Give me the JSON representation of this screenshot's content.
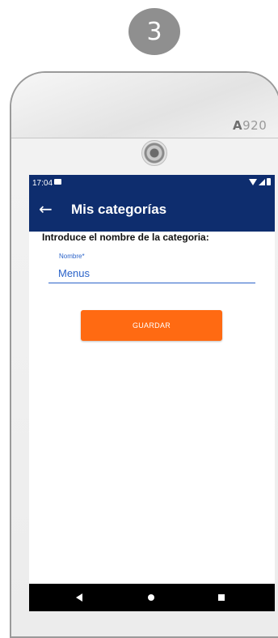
{
  "step": {
    "number": "3"
  },
  "device": {
    "model_prefix": "A",
    "model_number": "920"
  },
  "status_bar": {
    "time": "17:04"
  },
  "app_bar": {
    "title": "Mis categorías",
    "back_icon": "arrow-left-icon"
  },
  "form": {
    "prompt": "Introduce el nombre de la categoria:",
    "name_label": "Nombre*",
    "name_value": "Menus",
    "save_label": "GUARDAR"
  },
  "colors": {
    "app_bar": "#0e2d6e",
    "accent": "#2b63c9",
    "button": "#ff6a12",
    "badge": "#8f8f8f"
  }
}
